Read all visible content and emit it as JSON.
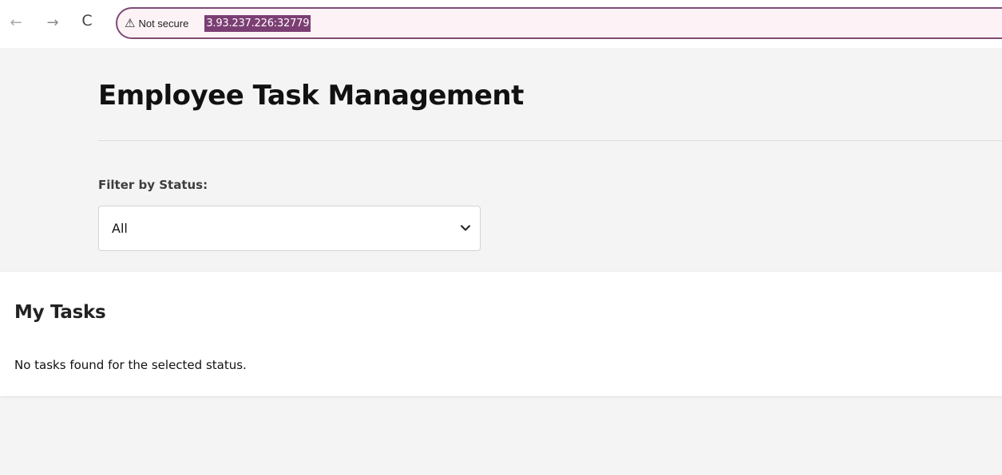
{
  "browser": {
    "back_glyph": "←",
    "forward_glyph": "→",
    "reload_glyph": "C",
    "warning_glyph": "⚠",
    "security_label": "Not secure",
    "url": "3.93.237.226:32779"
  },
  "page": {
    "title": "Employee Task Management",
    "filter": {
      "label": "Filter by Status:",
      "selected": "All",
      "chevron_glyph": "⌄"
    }
  },
  "tasks": {
    "heading": "My Tasks",
    "empty_message": "No tasks found for the selected status."
  },
  "colors": {
    "address_border": "#7f4b74",
    "url_highlight": "#7b3e73",
    "page_background": "#f4f4f4",
    "card_background": "#ffffff"
  }
}
